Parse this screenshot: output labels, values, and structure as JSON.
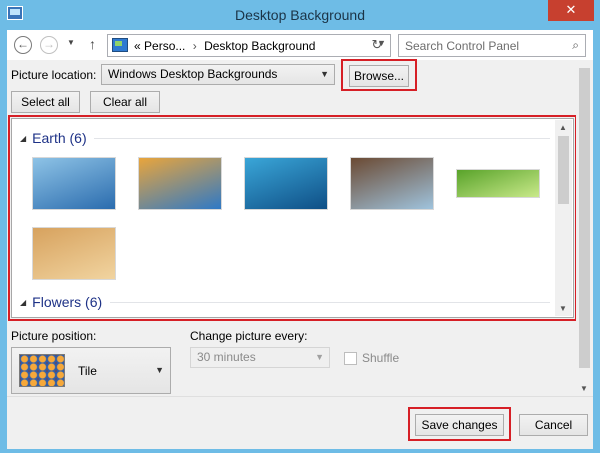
{
  "window": {
    "title": "Desktop Background",
    "close_glyph": "✕",
    "app_icon": "control-panel-icon"
  },
  "nav": {
    "back_glyph": "←",
    "forward_glyph": "→",
    "history_glyph": "▼",
    "up_glyph": "↑",
    "breadcrumb": [
      "Perso...",
      "Desktop Background"
    ],
    "breadcrumb_prefix": "«",
    "breadcrumb_sep": "›",
    "refresh_glyph": "↻",
    "search_placeholder": "Search Control Panel",
    "search_glyph": "⌕"
  },
  "picture_location": {
    "label": "Picture location:",
    "value": "Windows Desktop Backgrounds",
    "browse_label": "Browse..."
  },
  "selection": {
    "select_all": "Select all",
    "clear_all": "Clear all"
  },
  "groups": [
    {
      "name": "Earth (6)",
      "images": 6
    },
    {
      "name": "Flowers (6)",
      "images": 6
    }
  ],
  "thumb_colors": [
    [
      "#8ec3e6",
      "#2b6cae"
    ],
    [
      "#e9a53c",
      "#2f79c6"
    ],
    [
      "#3aa6d8",
      "#0f4f86"
    ],
    [
      "#6b4a33",
      "#9fc3dd"
    ],
    [
      "#59a32a",
      "#c9e98a"
    ],
    [
      "#d7a25e",
      "#f1d4a0"
    ]
  ],
  "picture_position": {
    "label": "Picture position:",
    "value": "Tile"
  },
  "change_every": {
    "label": "Change picture every:",
    "value": "30 minutes"
  },
  "shuffle": {
    "label": "Shuffle",
    "checked": false
  },
  "footer": {
    "save": "Save changes",
    "cancel": "Cancel"
  },
  "highlight_color": "#d61f26"
}
